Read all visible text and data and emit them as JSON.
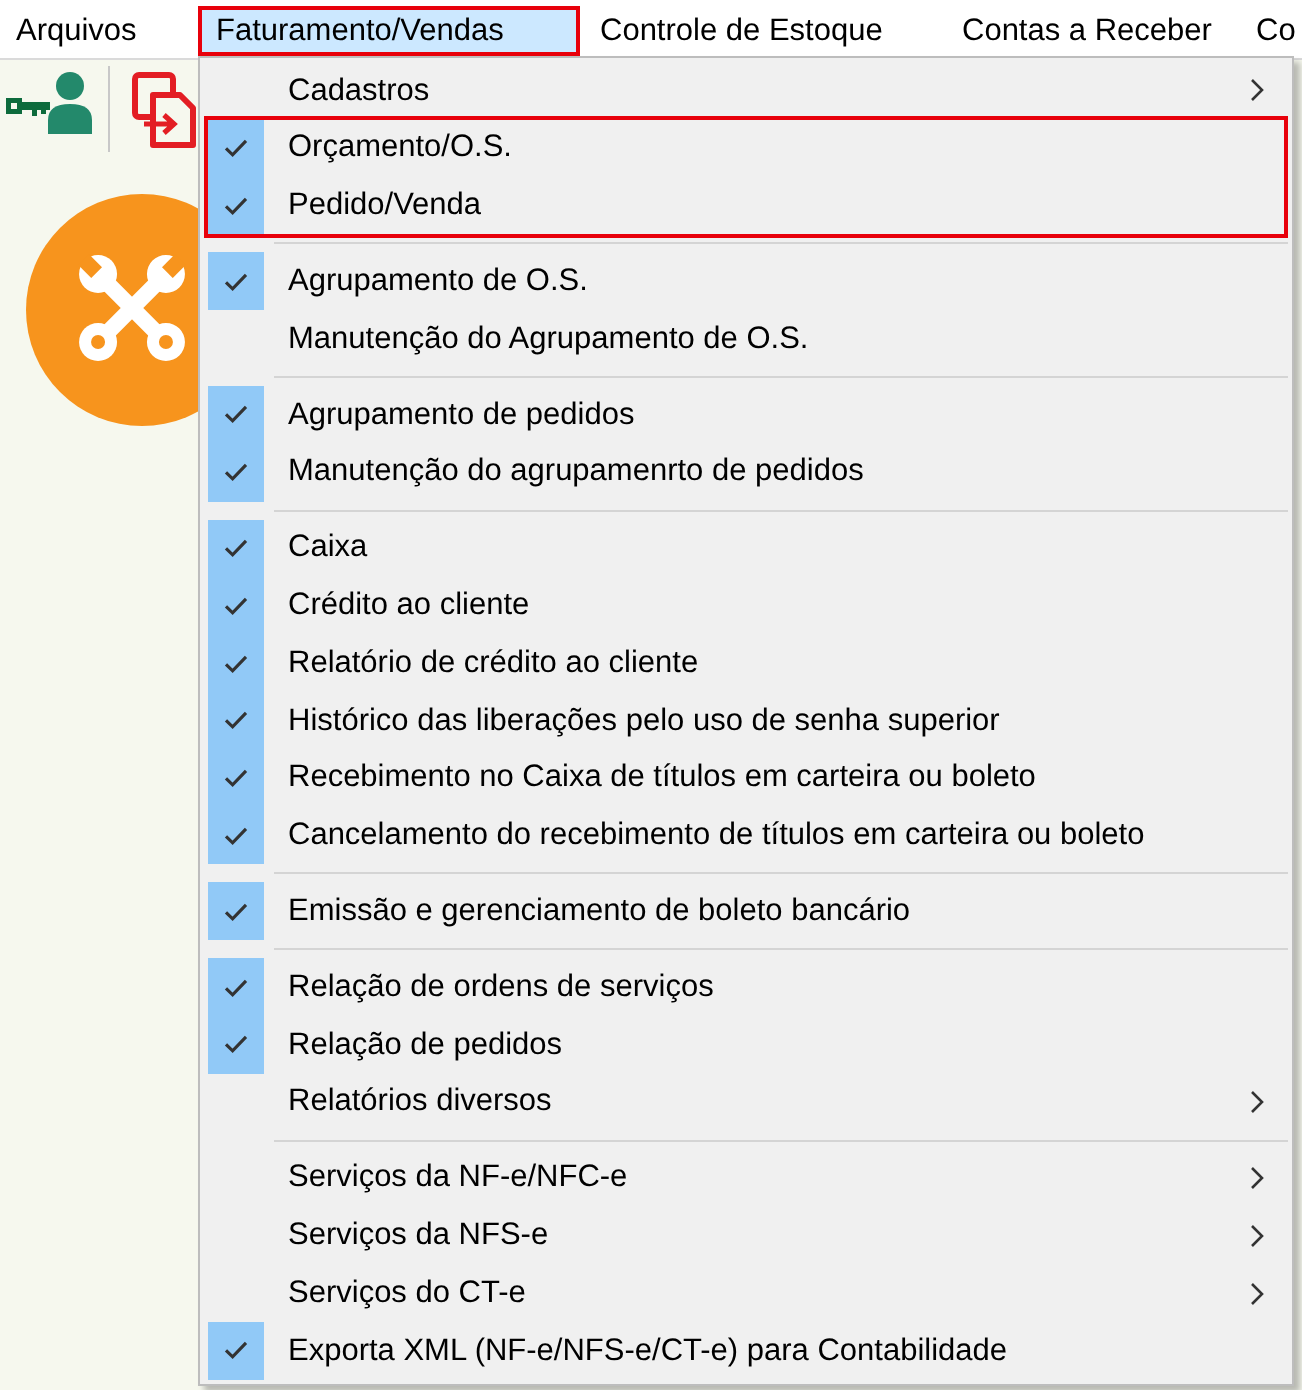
{
  "menubar": {
    "items": [
      {
        "label": "Arquivos",
        "selected": false,
        "framed": false
      },
      {
        "label": "Faturamento/Vendas",
        "selected": true,
        "framed": true
      },
      {
        "label": "Controle de Estoque",
        "selected": false,
        "framed": false
      },
      {
        "label": "Contas a Receber",
        "selected": false,
        "framed": false
      },
      {
        "label": "Co",
        "selected": false,
        "framed": false
      }
    ]
  },
  "menu": {
    "sections": [
      {
        "items": [
          {
            "label": "Cadastros",
            "checked": false,
            "submenu": true,
            "framed": false
          },
          {
            "label": "Orçamento/O.S.",
            "checked": true,
            "submenu": false,
            "framed": true
          },
          {
            "label": "Pedido/Venda",
            "checked": true,
            "submenu": false,
            "framed": true
          }
        ]
      },
      {
        "items": [
          {
            "label": "Agrupamento de O.S.",
            "checked": true,
            "submenu": false,
            "framed": false
          },
          {
            "label": "Manutenção do Agrupamento de O.S.",
            "checked": false,
            "submenu": false,
            "framed": false
          }
        ]
      },
      {
        "items": [
          {
            "label": "Agrupamento de pedidos",
            "checked": true,
            "submenu": false,
            "framed": false
          },
          {
            "label": "Manutenção do agrupamenrto de pedidos",
            "checked": true,
            "submenu": false,
            "framed": false
          }
        ]
      },
      {
        "items": [
          {
            "label": "Caixa",
            "checked": true,
            "submenu": false,
            "framed": false
          },
          {
            "label": "Crédito ao cliente",
            "checked": true,
            "submenu": false,
            "framed": false
          },
          {
            "label": "Relatório de crédito ao cliente",
            "checked": true,
            "submenu": false,
            "framed": false
          },
          {
            "label": "Histórico das liberações pelo uso de senha superior",
            "checked": true,
            "submenu": false,
            "framed": false
          },
          {
            "label": "Recebimento no Caixa de títulos em carteira ou boleto",
            "checked": true,
            "submenu": false,
            "framed": false
          },
          {
            "label": "Cancelamento do recebimento de títulos em carteira ou boleto",
            "checked": true,
            "submenu": false,
            "framed": false
          }
        ]
      },
      {
        "items": [
          {
            "label": "Emissão e gerenciamento de boleto bancário",
            "checked": true,
            "submenu": false,
            "framed": false
          }
        ]
      },
      {
        "items": [
          {
            "label": "Relação de ordens de serviços",
            "checked": true,
            "submenu": false,
            "framed": false
          },
          {
            "label": "Relação de pedidos",
            "checked": true,
            "submenu": false,
            "framed": false
          },
          {
            "label": "Relatórios diversos",
            "checked": false,
            "submenu": true,
            "framed": false
          }
        ]
      },
      {
        "items": [
          {
            "label": "Serviços da NF-e/NFC-e",
            "checked": false,
            "submenu": true,
            "framed": false
          },
          {
            "label": "Serviços da NFS-e",
            "checked": false,
            "submenu": true,
            "framed": false
          },
          {
            "label": "Serviços do CT-e",
            "checked": false,
            "submenu": true,
            "framed": false
          },
          {
            "label": "Exporta XML (NF-e/NFS-e/CT-e) para Contabilidade",
            "checked": true,
            "submenu": false,
            "framed": false
          }
        ]
      }
    ]
  }
}
